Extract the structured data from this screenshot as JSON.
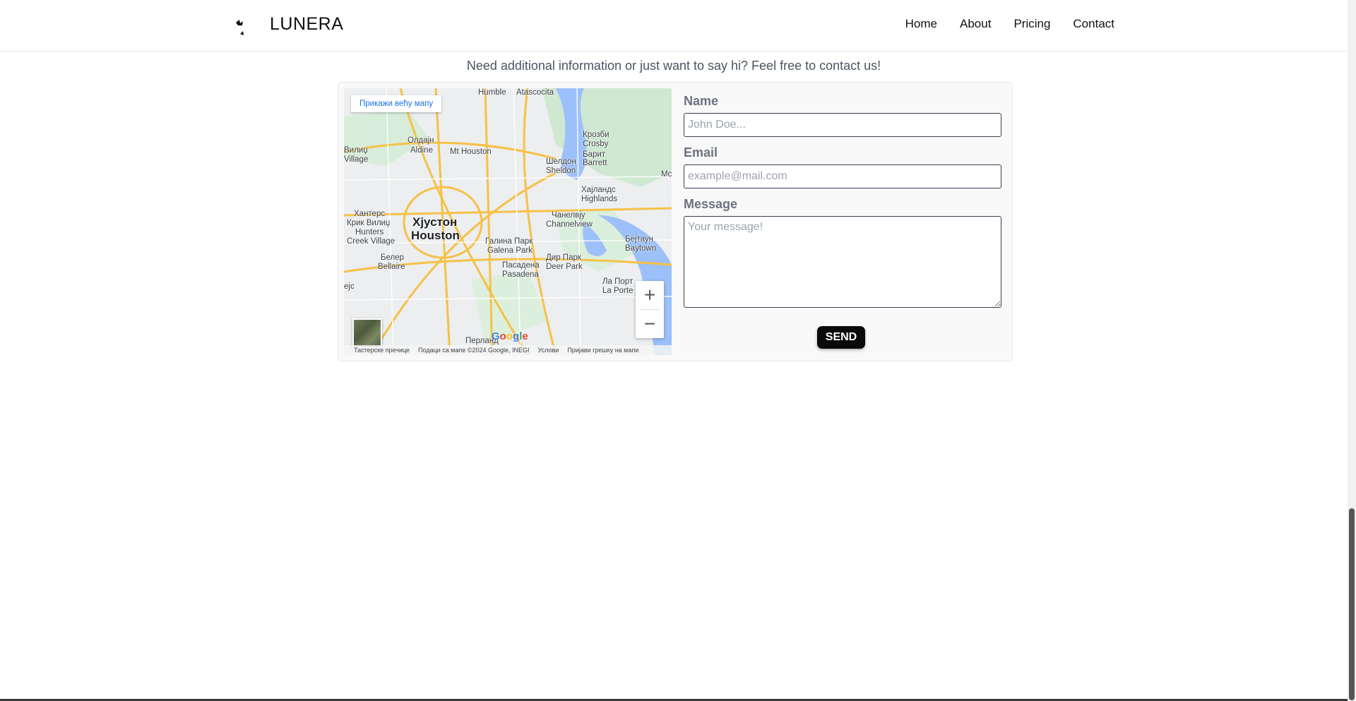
{
  "brand": {
    "name": "LUNERA"
  },
  "nav": {
    "items": [
      "Home",
      "About",
      "Pricing",
      "Contact"
    ]
  },
  "tagline": "Need additional information or just want to say hi? Feel free to contact us!",
  "map": {
    "larger_map_label": "Прикажи већу мапу",
    "city_cyrillic": "Хјустон",
    "city_latin": "Houston",
    "labels": [
      "Humble",
      "Atascocita",
      "Олдајн",
      "Aldine",
      "Mt Houston",
      "Вилиџ",
      "Village",
      "Крозби",
      "Crosby",
      "Барит",
      "Barrett",
      "Шелдон",
      "Sheldon",
      "Хајландс",
      "Highlands",
      "Хантерс",
      "Крик Вилиџ",
      "Hunters",
      "Creek Village",
      "Галина Парк",
      "Galena Park",
      "Чанелвју",
      "Channelview",
      "Бејтаун",
      "Baytown",
      "Белер",
      "Bellaire",
      "Дир Парк",
      "Deer Park",
      "Пасадена",
      "Pasadena",
      "Ла Порт",
      "La Porte",
      "Перланд",
      "Mc",
      "ејс"
    ],
    "zoom_in": "+",
    "zoom_out": "−",
    "google_logo": "Google",
    "footer": [
      "Тастерске пречице",
      "Подаци са мапе ©2024 Google, INEGI",
      "Услови",
      "Пријави грешку на мапи"
    ]
  },
  "form": {
    "name_label": "Name",
    "name_placeholder": "John Doe...",
    "email_label": "Email",
    "email_placeholder": "example@mail.com",
    "message_label": "Message",
    "message_placeholder": "Your message!",
    "send_label": "SEND"
  },
  "colors": {
    "text": "#111111",
    "muted": "#6b7280",
    "button": "#0a0a0a",
    "map_link": "#1a73e8"
  },
  "icons": {
    "logo": "moon-bat-icon",
    "satellite": "satellite-thumbnail-icon"
  }
}
